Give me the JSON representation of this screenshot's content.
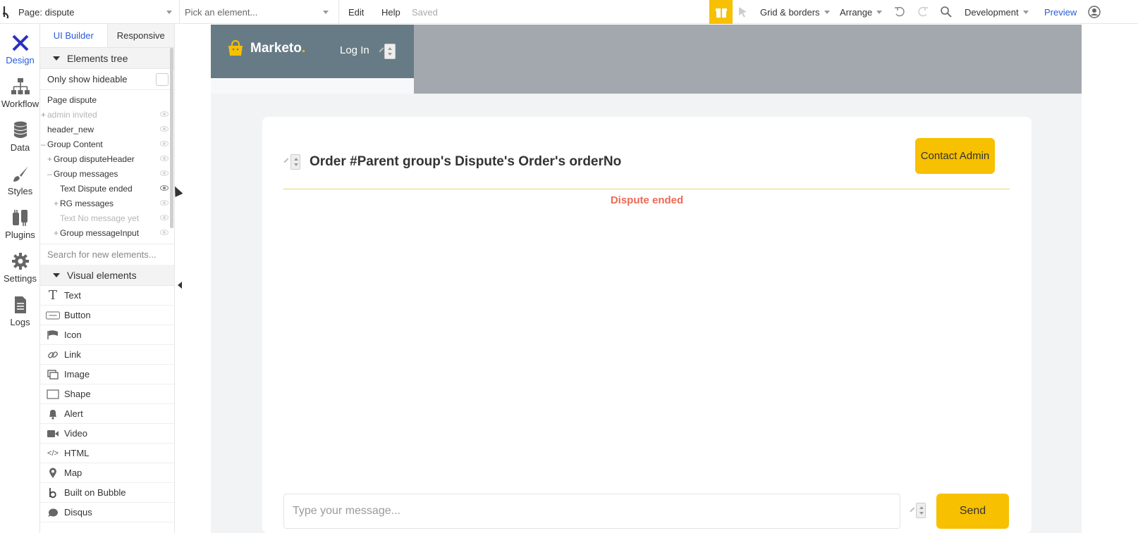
{
  "topbar": {
    "page_selector": "Page: dispute",
    "element_picker_placeholder": "Pick an element...",
    "edit": "Edit",
    "help": "Help",
    "saved": "Saved",
    "grid_borders": "Grid & borders",
    "arrange": "Arrange",
    "environment": "Development",
    "preview": "Preview",
    "accent_color": "#f7c000"
  },
  "rail": {
    "items": [
      {
        "label": "Design",
        "icon": "design-icon"
      },
      {
        "label": "Workflow",
        "icon": "workflow-icon"
      },
      {
        "label": "Data",
        "icon": "database-icon"
      },
      {
        "label": "Styles",
        "icon": "brush-icon"
      },
      {
        "label": "Plugins",
        "icon": "plug-icon"
      },
      {
        "label": "Settings",
        "icon": "gear-icon"
      },
      {
        "label": "Logs",
        "icon": "document-icon"
      }
    ]
  },
  "panel": {
    "tab_ui_builder": "UI Builder",
    "tab_responsive": "Responsive",
    "elements_tree": "Elements tree",
    "only_show_hideable": "Only show hideable",
    "tree": [
      {
        "label": "Page dispute"
      },
      {
        "label": "admin invited"
      },
      {
        "label": "header_new"
      },
      {
        "label": "Group Content"
      },
      {
        "label": "Group disputeHeader"
      },
      {
        "label": "Group messages"
      },
      {
        "label": "Text Dispute ended"
      },
      {
        "label": "RG messages"
      },
      {
        "label": "Text No message yet"
      },
      {
        "label": "Group messageInput"
      }
    ],
    "search_placeholder": "Search for new elements...",
    "visual_elements": "Visual elements",
    "visual_items": [
      {
        "label": "Text",
        "icon": "T"
      },
      {
        "label": "Button",
        "icon": "button-icon"
      },
      {
        "label": "Icon",
        "icon": "flag-icon"
      },
      {
        "label": "Link",
        "icon": "link-icon"
      },
      {
        "label": "Image",
        "icon": "image-icon"
      },
      {
        "label": "Shape",
        "icon": "shape-icon"
      },
      {
        "label": "Alert",
        "icon": "bell-icon"
      },
      {
        "label": "Video",
        "icon": "video-icon"
      },
      {
        "label": "HTML",
        "icon": "code-icon"
      },
      {
        "label": "Map",
        "icon": "map-pin-icon"
      },
      {
        "label": "Built on Bubble",
        "icon": "bubble-icon"
      },
      {
        "label": "Disqus",
        "icon": "disqus-icon"
      }
    ]
  },
  "canvas": {
    "logo_text": "Marketo",
    "logo_dot": ".",
    "login": "Log In",
    "order_title": "Order #Parent group's Dispute's Order's orderNo",
    "contact_admin": "Contact Admin",
    "dispute_ended": "Dispute ended",
    "message_placeholder": "Type your message...",
    "send": "Send"
  }
}
